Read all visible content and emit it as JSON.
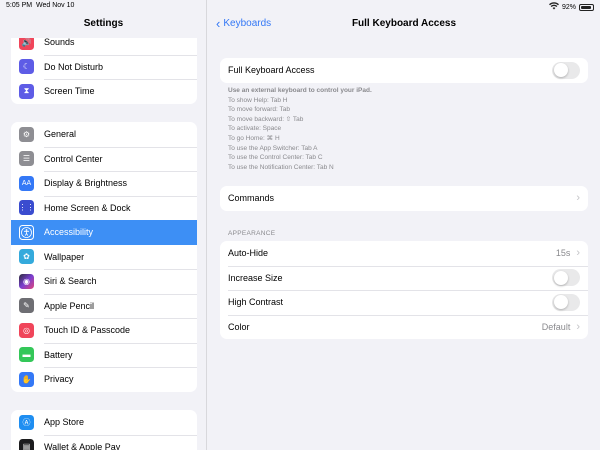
{
  "status": {
    "time": "5:05 PM",
    "date": "Wed Nov 10",
    "battery": "92%"
  },
  "sidebar": {
    "title": "Settings",
    "groups": [
      [
        {
          "label": "Sounds",
          "icon": "speaker-icon",
          "color": "#f0455a"
        },
        {
          "label": "Do Not Disturb",
          "icon": "moon-icon",
          "color": "#5e5ce6"
        },
        {
          "label": "Screen Time",
          "icon": "hourglass-icon",
          "color": "#5e5ce6"
        }
      ],
      [
        {
          "label": "General",
          "icon": "gear-icon",
          "color": "#8e8e93"
        },
        {
          "label": "Control Center",
          "icon": "switches-icon",
          "color": "#8e8e93"
        },
        {
          "label": "Display & Brightness",
          "icon": "text-size-icon",
          "color": "#3478f6"
        },
        {
          "label": "Home Screen & Dock",
          "icon": "grid-icon",
          "color": "#3a4ccf"
        },
        {
          "label": "Accessibility",
          "icon": "accessibility-icon",
          "color": "#3478f6",
          "selected": true
        },
        {
          "label": "Wallpaper",
          "icon": "flower-icon",
          "color": "#34aadc"
        },
        {
          "label": "Siri & Search",
          "icon": "siri-icon",
          "color": "#2b2b3a"
        },
        {
          "label": "Apple Pencil",
          "icon": "pencil-icon",
          "color": "#6e6e73"
        },
        {
          "label": "Touch ID & Passcode",
          "icon": "fingerprint-icon",
          "color": "#f0455a"
        },
        {
          "label": "Battery",
          "icon": "battery-icon",
          "color": "#34c759"
        },
        {
          "label": "Privacy",
          "icon": "hand-icon",
          "color": "#3478f6"
        }
      ],
      [
        {
          "label": "App Store",
          "icon": "app-store-icon",
          "color": "#1f8ef1"
        },
        {
          "label": "Wallet & Apple Pay",
          "icon": "wallet-icon",
          "color": "#1c1c1e"
        }
      ]
    ]
  },
  "detail": {
    "back_label": "Keyboards",
    "title": "Full Keyboard Access",
    "main_toggle_label": "Full Keyboard Access",
    "footer_title": "Use an external keyboard to control your iPad.",
    "footer_lines": [
      "To show Help: Tab H",
      "To move forward: Tab",
      "To move backward: ⇧ Tab",
      "To activate: Space",
      "To go Home: ⌘ H",
      "To use the App Switcher: Tab A",
      "To use the Control Center: Tab C",
      "To use the Notification Center: Tab N"
    ],
    "commands_label": "Commands",
    "appearance_header": "APPEARANCE",
    "appearance_rows": {
      "auto_hide": {
        "label": "Auto-Hide",
        "value": "15s"
      },
      "increase_size": {
        "label": "Increase Size"
      },
      "high_contrast": {
        "label": "High Contrast"
      },
      "color": {
        "label": "Color",
        "value": "Default"
      }
    }
  }
}
